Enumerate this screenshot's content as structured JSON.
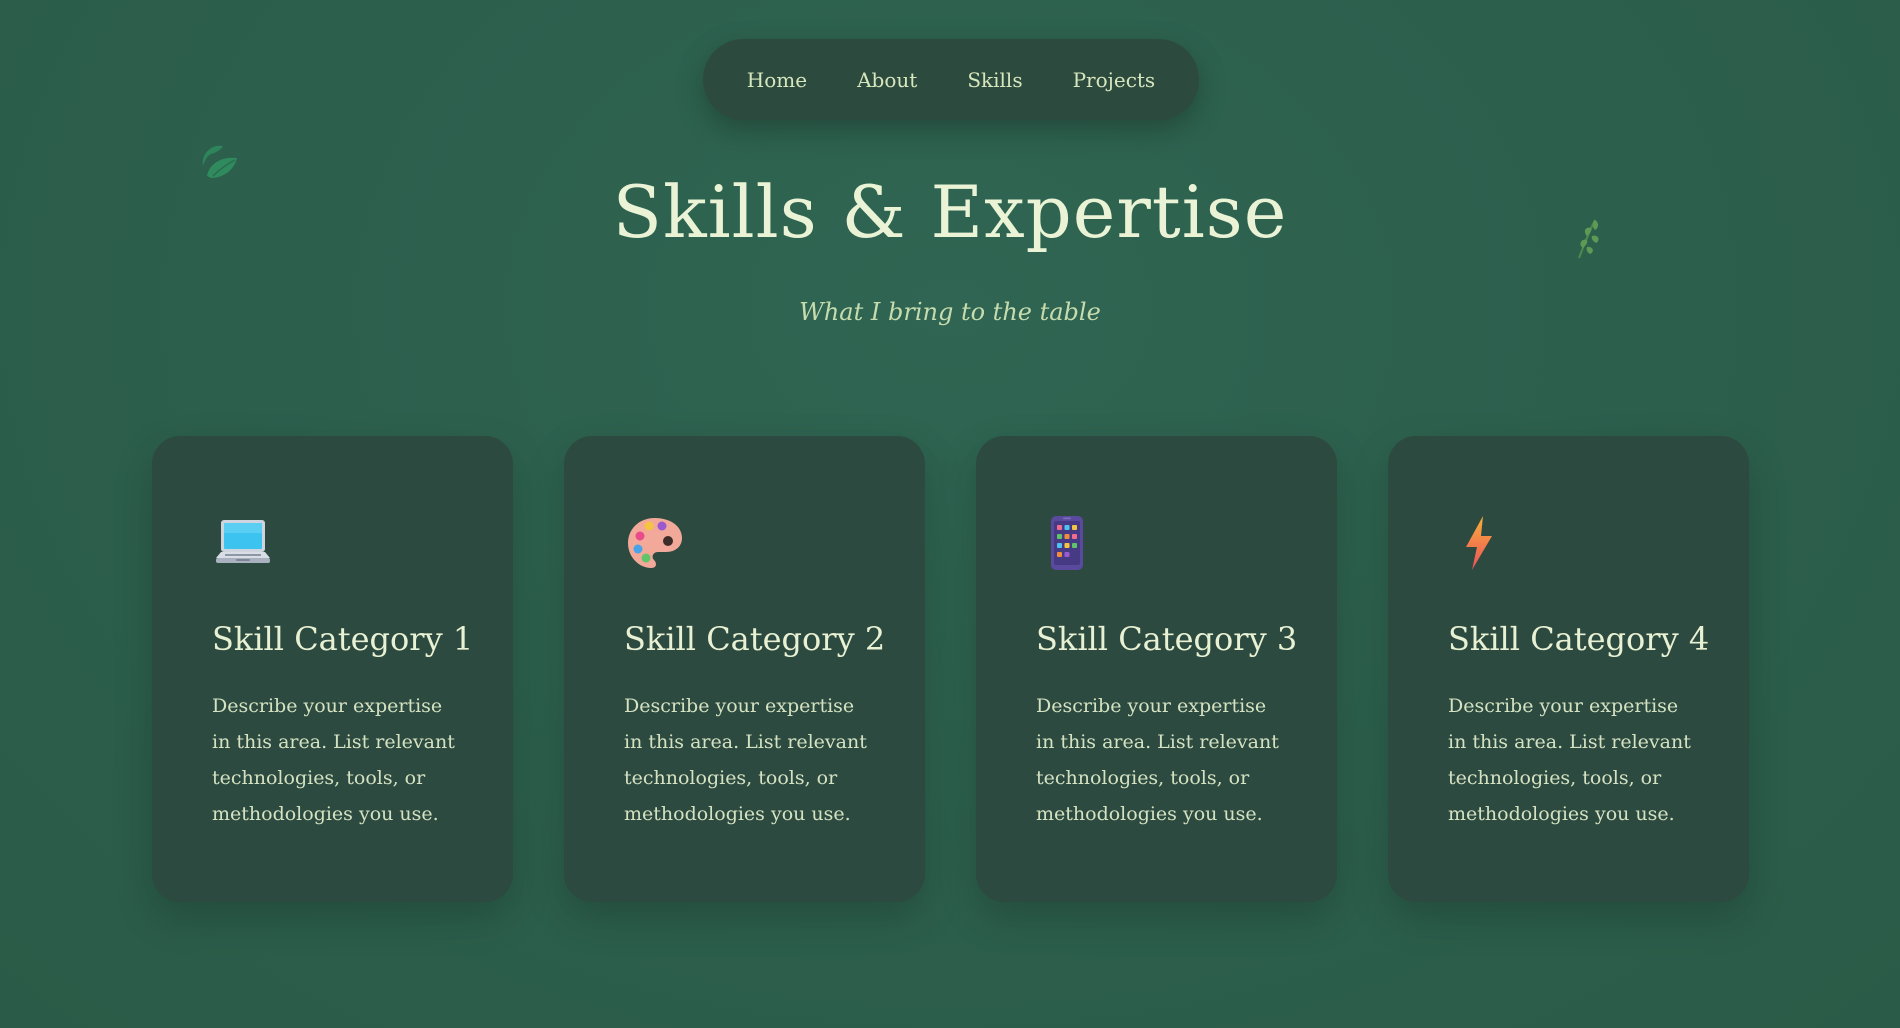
{
  "nav": {
    "items": [
      {
        "label": "Home"
      },
      {
        "label": "About"
      },
      {
        "label": "Skills"
      },
      {
        "label": "Projects"
      }
    ]
  },
  "hero": {
    "title": "Skills & Expertise",
    "subtitle": "What I bring to the table"
  },
  "cards": [
    {
      "icon": "laptop-icon",
      "title": "Skill Category 1",
      "description": "Describe your expertise in this area. List relevant technologies, tools, or methodologies you use."
    },
    {
      "icon": "palette-icon",
      "title": "Skill Category 2",
      "description": "Describe your expertise in this area. List relevant technologies, tools, or methodologies you use."
    },
    {
      "icon": "mobile-phone-icon",
      "title": "Skill Category 3",
      "description": "Describe your expertise in this area. List relevant technologies, tools, or methodologies you use."
    },
    {
      "icon": "lightning-icon",
      "title": "Skill Category 4",
      "description": "Describe your expertise in this area. List relevant technologies, tools, or methodologies you use."
    }
  ],
  "colors": {
    "background": "#2c5f4c",
    "card": "#2d4a40",
    "nav": "#2d4a3e",
    "title": "#eaf3d6",
    "subtitle": "#c7dcae"
  }
}
